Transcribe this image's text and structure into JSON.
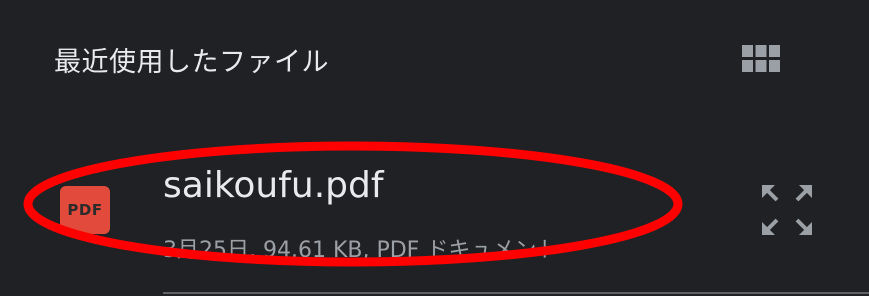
{
  "section": {
    "title": "最近使用したファイル"
  },
  "icons": {
    "view_toggle": "grid-view-icon",
    "file_type": "pdf-icon",
    "preview": "expand-icon"
  },
  "files": [
    {
      "name": "saikoufu.pdf",
      "type_badge": "PDF",
      "meta": "3月25日, 94.61 KB, PDF ドキュメント"
    }
  ],
  "colors": {
    "background": "#202124",
    "pdf_badge": "#e24b3b",
    "annotation": "#ff0000",
    "primary_text": "#e8eaed",
    "secondary_text": "#9aa0a6"
  }
}
